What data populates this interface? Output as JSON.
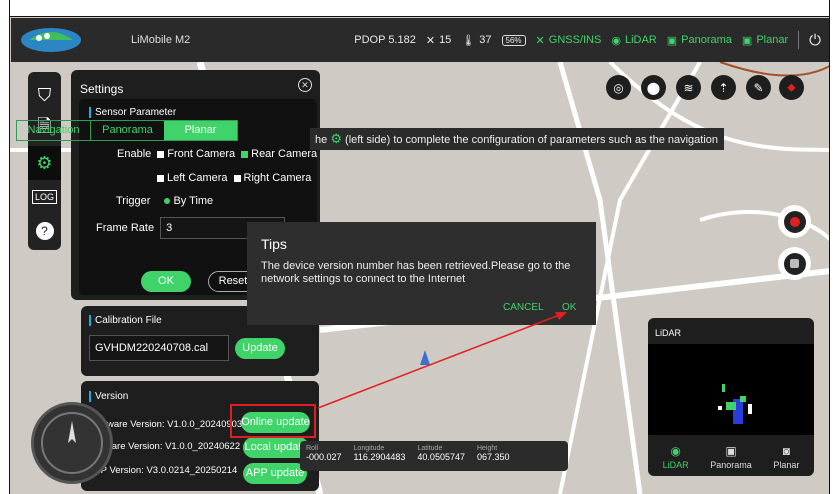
{
  "topbar": {
    "app_title": "LiMobile M2",
    "pdop": "PDOP 5.182",
    "satellites": "15",
    "temperature": "37",
    "battery": "56%",
    "gnss": "GNSS/INS",
    "lidar": "LiDAR",
    "panorama": "Panorama",
    "planar": "Planar"
  },
  "settings": {
    "title": "Settings",
    "sensor_parameter": "Sensor Parameter",
    "tabs": [
      "Navigation",
      "Panorama",
      "Planar"
    ],
    "active_tab": "Planar",
    "enable_label": "Enable",
    "front_camera": "Front Camera",
    "rear_camera": "Rear Camera",
    "left_camera": "Left Camera",
    "right_camera": "Right Camera",
    "trigger_label": "Trigger",
    "trigger_value": "By Time",
    "frame_rate_label": "Frame Rate",
    "frame_rate_value": "3",
    "ok": "OK",
    "reset": "Reset"
  },
  "calibration": {
    "title": "Calibration File",
    "file": "GVHDM220240708.cal",
    "update": "Update"
  },
  "version": {
    "title": "Version",
    "firmware": "Firmware Version: V1.0.0_20240903",
    "software": "Software Version: V1.0.0_20240622",
    "app": "APP Version: V3.0.0214_20250214",
    "online_update": "Online update",
    "local_update": "Local update",
    "app_update": "APP update"
  },
  "banner": {
    "prefix": "he",
    "text": "(left side) to complete the configuration of parameters such as the navigation"
  },
  "dialog": {
    "title": "Tips",
    "message": "The device version number has been retrieved.Please go to the network settings to connect to the Internet",
    "cancel": "CANCEL",
    "ok": "OK"
  },
  "coords": {
    "roll_label": "Roll",
    "roll": "-000.027",
    "lon_label": "Longitude",
    "lon": "116.2904483",
    "lat_label": "Latitude",
    "lat": "40.0505747",
    "height_label": "Height",
    "height": "067.350"
  },
  "lidar_panel": {
    "title": "LiDAR",
    "tabs": [
      "LiDAR",
      "Panorama",
      "Planar"
    ],
    "active_tab": "LiDAR"
  },
  "colors": {
    "accent": "#3fd36a",
    "highlight": "#e02020",
    "panel": "#1e1e1e"
  }
}
